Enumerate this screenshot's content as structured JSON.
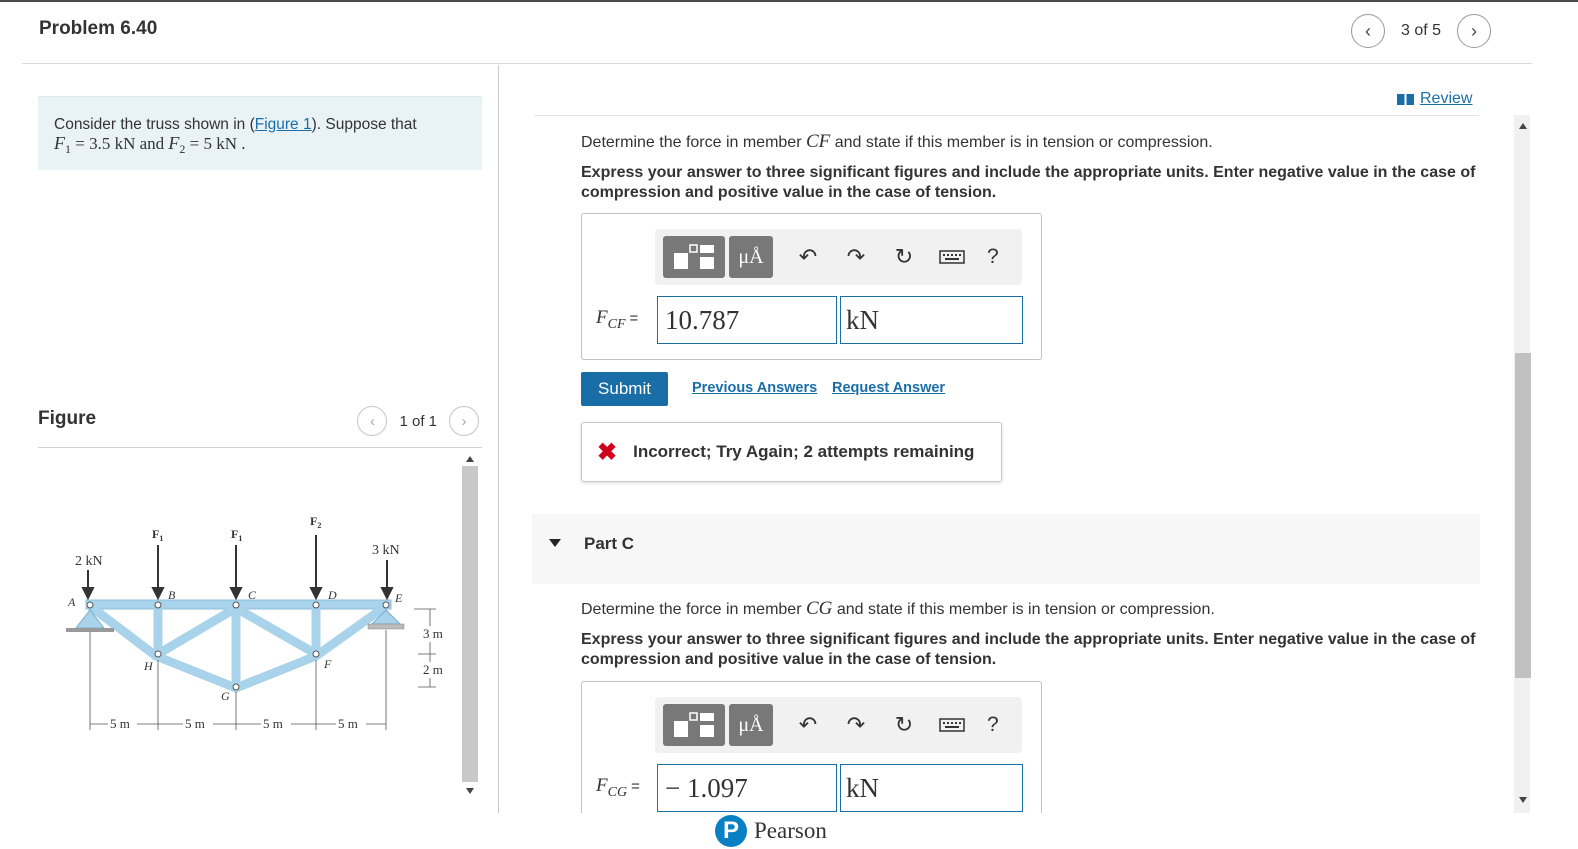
{
  "header": {
    "title": "Problem 6.40",
    "nav_position": "3 of 5"
  },
  "problem": {
    "intro": "Consider the truss shown in (",
    "figure_link": "Figure 1",
    "after_link": "). Suppose that",
    "f1_sym": "F",
    "f1_sub": "1",
    "f1_val": " = 3.5  kN and ",
    "f2_sym": "F",
    "f2_sub": "2",
    "f2_val": " = 5  kN ."
  },
  "figure": {
    "title": "Figure",
    "nav_position": "1 of 1",
    "labels": {
      "load_2kn": "2 kN",
      "load_3kn": "3 kN",
      "f1": "F",
      "f1_sub": "1",
      "f2": "F",
      "f2_sub": "2",
      "node_a": "A",
      "node_b": "B",
      "node_c": "C",
      "node_d": "D",
      "node_e": "E",
      "node_f": "F",
      "node_g": "G",
      "node_h": "H",
      "dim_3m": "3 m",
      "dim_2m": "2 m",
      "span": "5 m"
    }
  },
  "review": {
    "label": "Review"
  },
  "part_b": {
    "question_pre": "Determine the force in member ",
    "member": "CF",
    "question_post": " and state if this member is in tension or compression.",
    "instructions": "Express your answer to three significant figures and include the appropriate units. Enter negative value in the case of compression and positive value in the case of tension.",
    "field_sym": "F",
    "field_sub": "CF",
    "field_eq": "=",
    "value": "10.787",
    "unit": "kN",
    "submit": "Submit",
    "previous_answers": "Previous Answers",
    "request_answer": "Request Answer",
    "feedback": "Incorrect; Try Again; 2 attempts remaining"
  },
  "toolbar": {
    "units_btn": "μÅ",
    "help": "?"
  },
  "part_c": {
    "title": "Part C",
    "question_pre": "Determine the force in member ",
    "member": "CG",
    "question_post": " and state if this member is in tension or compression.",
    "instructions": "Express your answer to three significant figures and include the appropriate units. Enter negative value in the case of compression and positive value in the case of tension.",
    "field_sym": "F",
    "field_sub": "CG",
    "field_eq": "=",
    "value": "− 1.097",
    "unit": "kN"
  },
  "footer": {
    "brand": "Pearson",
    "logo_letter": "P"
  },
  "colors": {
    "link": "#1a6ea8",
    "info_bg": "#e9f3f6",
    "error": "#d0021b",
    "truss": "#a9d3ea"
  }
}
